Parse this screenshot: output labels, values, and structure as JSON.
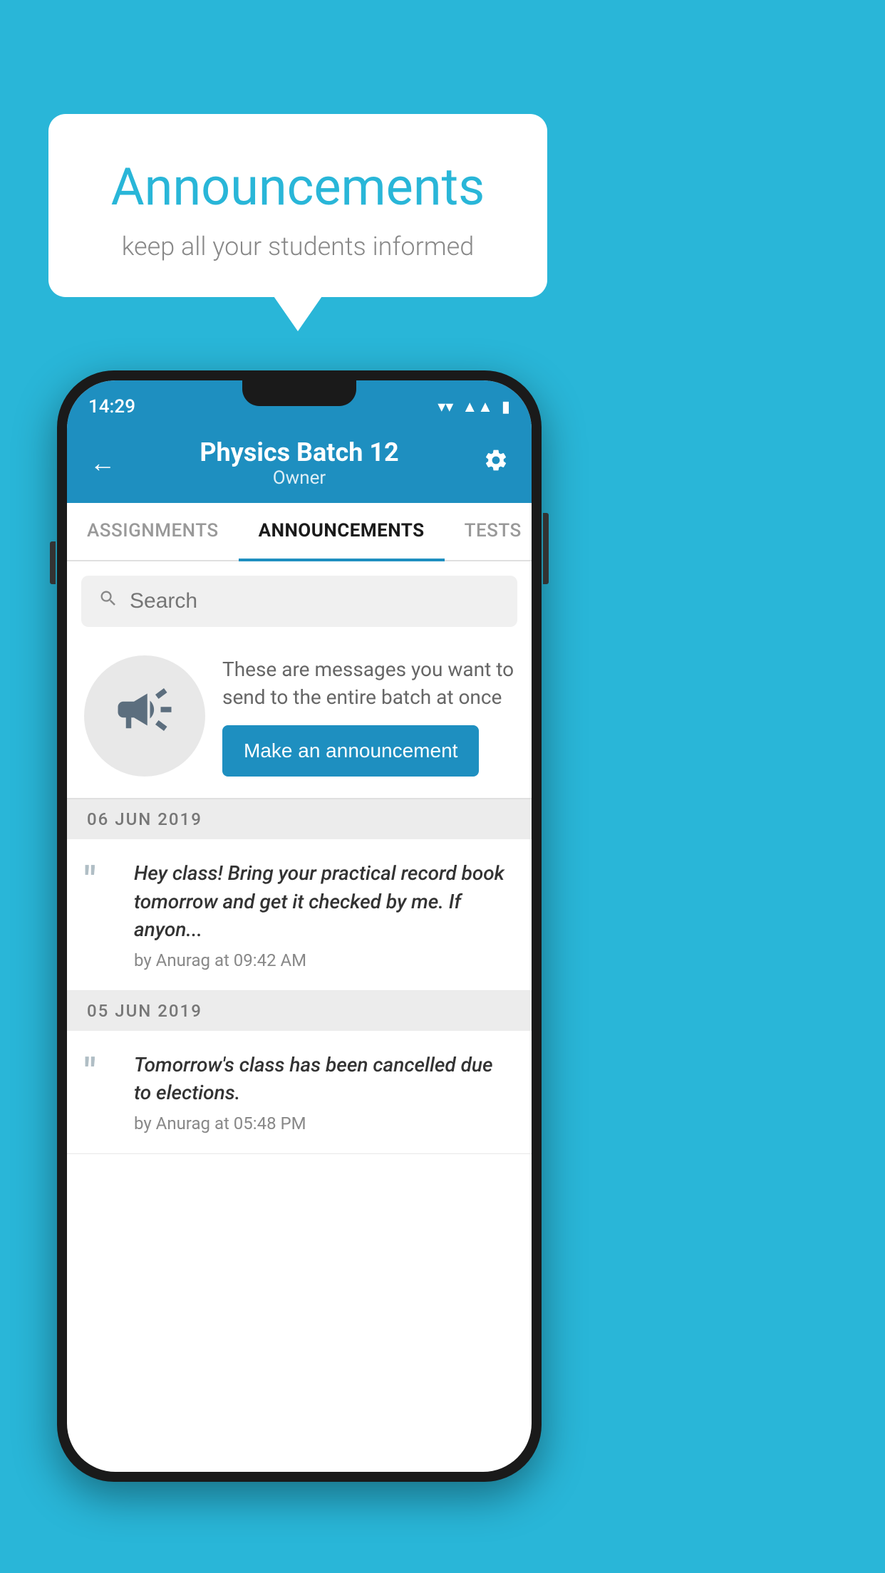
{
  "background_color": "#29b6d8",
  "speech_bubble": {
    "title": "Announcements",
    "subtitle": "keep all your students informed"
  },
  "phone": {
    "status_bar": {
      "time": "14:29"
    },
    "header": {
      "batch_name": "Physics Batch 12",
      "role": "Owner",
      "back_label": "←",
      "settings_label": "⚙"
    },
    "tabs": [
      {
        "label": "ASSIGNMENTS",
        "active": false
      },
      {
        "label": "ANNOUNCEMENTS",
        "active": true
      },
      {
        "label": "TESTS",
        "active": false
      }
    ],
    "search": {
      "placeholder": "Search"
    },
    "promo": {
      "text": "These are messages you want to send to the entire batch at once",
      "button_label": "Make an announcement"
    },
    "announcements": [
      {
        "date": "06  JUN  2019",
        "items": [
          {
            "text": "Hey class! Bring your practical record book tomorrow and get it checked by me. If anyon...",
            "meta": "by Anurag at 09:42 AM"
          }
        ]
      },
      {
        "date": "05  JUN  2019",
        "items": [
          {
            "text": "Tomorrow's class has been cancelled due to elections.",
            "meta": "by Anurag at 05:48 PM"
          }
        ]
      }
    ]
  }
}
